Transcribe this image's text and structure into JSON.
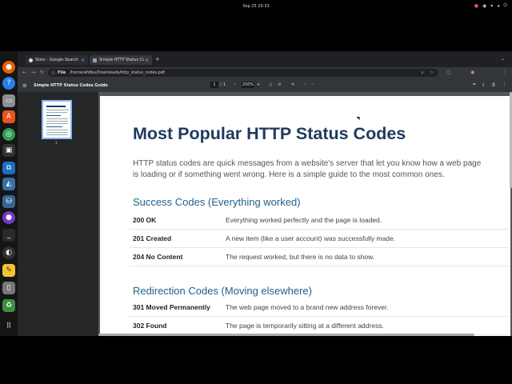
{
  "system": {
    "clock": "Sep 25  20:33",
    "tray_icons": [
      "record-icon",
      "accessibility-icon",
      "network-icon",
      "volume-icon",
      "power-icon"
    ]
  },
  "dock": {
    "items": [
      "firefox-icon",
      "help-icon",
      "files-icon",
      "app-store-icon",
      "chrome-icon",
      "terminal-icon",
      "vscode-icon",
      "android-studio-icon",
      "database-icon",
      "tor-icon",
      "console-icon",
      "obs-icon",
      "notes-icon",
      "trash-placeholder-icon",
      "recycle-icon",
      "app-grid-icon"
    ]
  },
  "browser": {
    "tabs": [
      {
        "label": "Stats - Google Search",
        "active": false
      },
      {
        "label": "Simple HTTP Status Codes Guide",
        "active": true
      }
    ],
    "new_tab": "+",
    "address": {
      "scheme_label": "File",
      "path": "/home/afidku/Downloads/http_status_codes.pdf"
    }
  },
  "pdf_toolbar": {
    "title": "Simple HTTP Status Codes Guide",
    "page_current": "1",
    "page_sep": "/",
    "page_total": "1",
    "zoom": "200%",
    "minus": "–",
    "plus": "+"
  },
  "sidebar": {
    "thumbnail_page": "1"
  },
  "document": {
    "title": "Most Popular HTTP Status Codes",
    "intro": "HTTP status codes are quick messages from a website's server that let you know how a web page is loading or if something went wrong. Here is a simple guide to the most common ones.",
    "sections": [
      {
        "heading": "Success Codes (Everything worked)",
        "rows": [
          {
            "code": "200 OK",
            "desc": "Everything worked perfectly and the page is loaded."
          },
          {
            "code": "201 Created",
            "desc": "A new item (like a user account) was successfully made."
          },
          {
            "code": "204 No Content",
            "desc": "The request worked, but there is no data to show."
          }
        ]
      },
      {
        "heading": "Redirection Codes (Moving elsewhere)",
        "rows": [
          {
            "code": "301 Moved Permanently",
            "desc": "The web page moved to a brand new address forever."
          },
          {
            "code": "302 Found",
            "desc": "The page is temporarily sitting at a different address."
          }
        ]
      }
    ]
  }
}
